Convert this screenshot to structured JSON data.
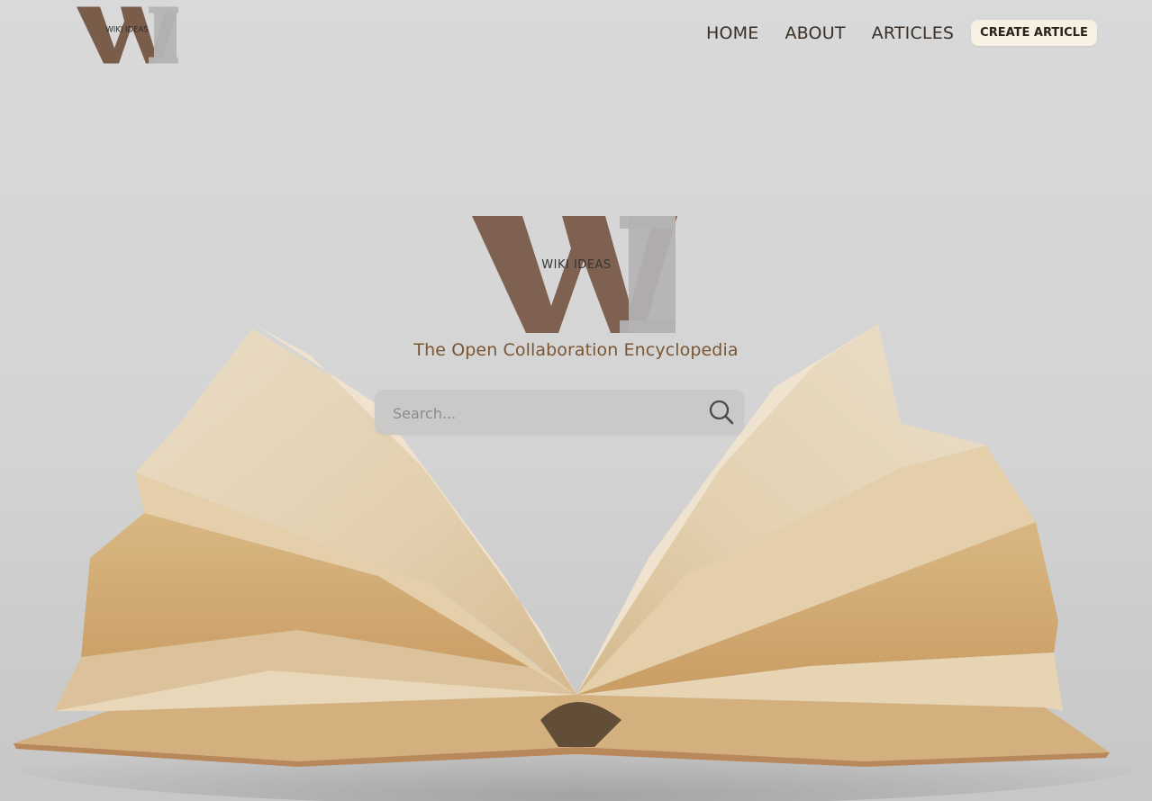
{
  "brand": {
    "logo_text": "WIKI IDEAS",
    "logo_letters": "WI",
    "colors": {
      "brown": "#7a5c4a",
      "grey": "#b5b5b5",
      "text_dark": "#3a2f26",
      "tagline": "#7a5634"
    }
  },
  "nav": {
    "items": [
      {
        "label": "HOME"
      },
      {
        "label": "ABOUT"
      },
      {
        "label": "ARTICLES"
      }
    ],
    "cta_label": "CREATE ARTICLE"
  },
  "hero": {
    "tagline": "The Open Collaboration Encyclopedia",
    "background": "open-book-photo"
  },
  "search": {
    "placeholder": "Search...",
    "value": "",
    "icon": "search-icon"
  }
}
